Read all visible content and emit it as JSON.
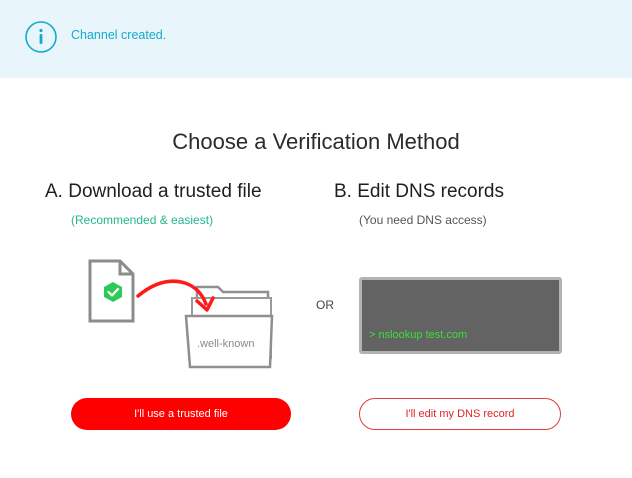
{
  "banner": {
    "message": "Channel created.",
    "icon": "info-icon"
  },
  "page": {
    "title": "Choose a Verification Method"
  },
  "options": {
    "a": {
      "title": "A.  Download a trusted file",
      "subtitle": "(Recommended & easiest)",
      "folder_label": ".well-known",
      "button_label": "I'll use a trusted file"
    },
    "or_label": "OR",
    "b": {
      "title": "B.  Edit DNS records",
      "subtitle": "(You need DNS access)",
      "terminal_text": "> nslookup test.com",
      "button_label": "I'll edit my DNS record"
    }
  },
  "colors": {
    "accent": "#16a9c9",
    "recommended": "#24b58e",
    "primary_button": "#ff0000",
    "terminal_bg": "#636363",
    "terminal_text": "#39e03a"
  }
}
